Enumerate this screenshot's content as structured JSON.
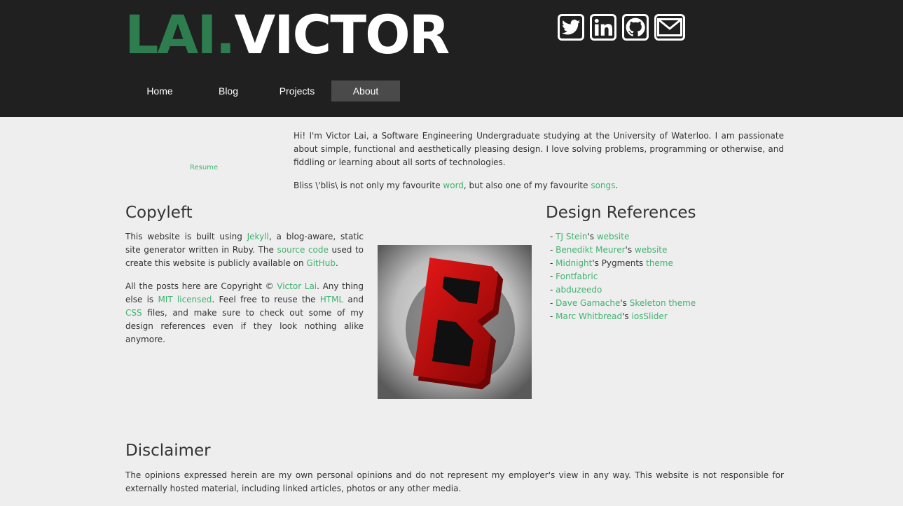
{
  "header": {
    "logo_part1": "LAI.",
    "logo_part2": "VICTOR",
    "social": [
      "twitter-icon",
      "linkedin-icon",
      "github-icon",
      "email-icon"
    ]
  },
  "nav": {
    "items": [
      "Home",
      "Blog",
      "Projects",
      "About"
    ],
    "active": "About"
  },
  "intro": {
    "resume_link": "Resume",
    "p1": "Hi! I'm Victor Lai, a Software Engineering Undergraduate studying at the University of Waterloo. I am passionate about simple, functional and aesthetically pleasing design. I love solving problems, programming or otherwise, and fiddling or learning about all sorts of technologies.",
    "p2_before": "Bliss \\'blis\\ is not only my favourite ",
    "p2_link1": "word",
    "p2_mid": ", but also one of my favourite ",
    "p2_link2": "songs",
    "p2_end": "."
  },
  "copyleft": {
    "title": "Copyleft",
    "p1_a": "This website is built using ",
    "p1_link1": "Jekyll",
    "p1_b": ", a blog-aware, static site generator written in Ruby. The ",
    "p1_link2": "source code",
    "p1_c": " used to create this website is publicly available on ",
    "p1_link3": "GitHub",
    "p1_d": ".",
    "p2_a": "All the posts here are Copyright © ",
    "p2_link1": "Victor Lai",
    "p2_b": ". Any thing else is ",
    "p2_link2": "MIT licensed",
    "p2_c": ". Feel free to reuse the ",
    "p2_link3": "HTML",
    "p2_d": " and ",
    "p2_link4": "CSS",
    "p2_e": " files, and make sure to check out some of my design references even if they look nothing alike anymore."
  },
  "references": {
    "title": "Design References",
    "r1": {
      "a": "TJ Stein",
      "b": "'s ",
      "c": "website"
    },
    "r2": {
      "a": "Benedikt Meurer",
      "b": "'s ",
      "c": "website"
    },
    "r3": {
      "a": "Midnight",
      "b": "'s Pygments ",
      "c": "theme"
    },
    "r4": {
      "a": "Fontfabric"
    },
    "r5": {
      "a": "abduzeedo"
    },
    "r6": {
      "a": "Dave Gamache",
      "b": "'s ",
      "c": "Skeleton theme"
    },
    "r7": {
      "a": "Marc Whitbread",
      "b": "'s ",
      "c": "iosSlider"
    },
    "bullet": "- "
  },
  "disclaimer": {
    "title": "Disclaimer",
    "text": "The opinions expressed herein are my own personal opinions and do not represent my employer's view in any way. This website is not responsible for externally hosted material, including linked articles, photos or any other media."
  },
  "colors": {
    "header_bg": "#202020",
    "logo_green": "#2e7d4f",
    "link_green": "#3fb36f",
    "page_bg": "#eeeeee",
    "nav_active": "#4a4a4a"
  }
}
